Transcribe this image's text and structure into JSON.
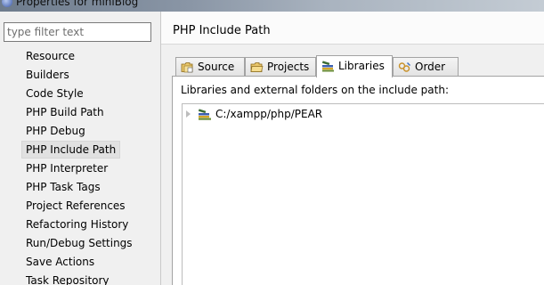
{
  "window": {
    "title": "Properties for miniBlog"
  },
  "filter": {
    "placeholder": "type filter text",
    "value": ""
  },
  "nav": {
    "items": [
      {
        "label": "Resource"
      },
      {
        "label": "Builders"
      },
      {
        "label": "Code Style"
      },
      {
        "label": "PHP Build Path"
      },
      {
        "label": "PHP Debug"
      },
      {
        "label": "PHP Include Path"
      },
      {
        "label": "PHP Interpreter"
      },
      {
        "label": "PHP Task Tags"
      },
      {
        "label": "Project References"
      },
      {
        "label": "Refactoring History"
      },
      {
        "label": "Run/Debug Settings"
      },
      {
        "label": "Save Actions"
      },
      {
        "label": "Task Repository"
      }
    ],
    "selected": "PHP Include Path"
  },
  "page": {
    "title": "PHP Include Path"
  },
  "tabs": [
    {
      "label": "Source",
      "icon": "source-folder-icon"
    },
    {
      "label": "Projects",
      "icon": "projects-icon"
    },
    {
      "label": "Libraries",
      "icon": "libraries-icon"
    },
    {
      "label": "Order",
      "icon": "order-icon"
    }
  ],
  "active_tab": "Libraries",
  "libraries": {
    "description": "Libraries and external folders on the include path:",
    "entries": [
      {
        "label": "C:/xampp/php/PEAR",
        "icon": "library-folder-icon"
      }
    ]
  },
  "colors": {
    "title_bar_start": "#6d7b8c",
    "selection_background": "#e1e1e1",
    "panel_background": "#ffffff",
    "window_background": "#f0f0f0"
  }
}
